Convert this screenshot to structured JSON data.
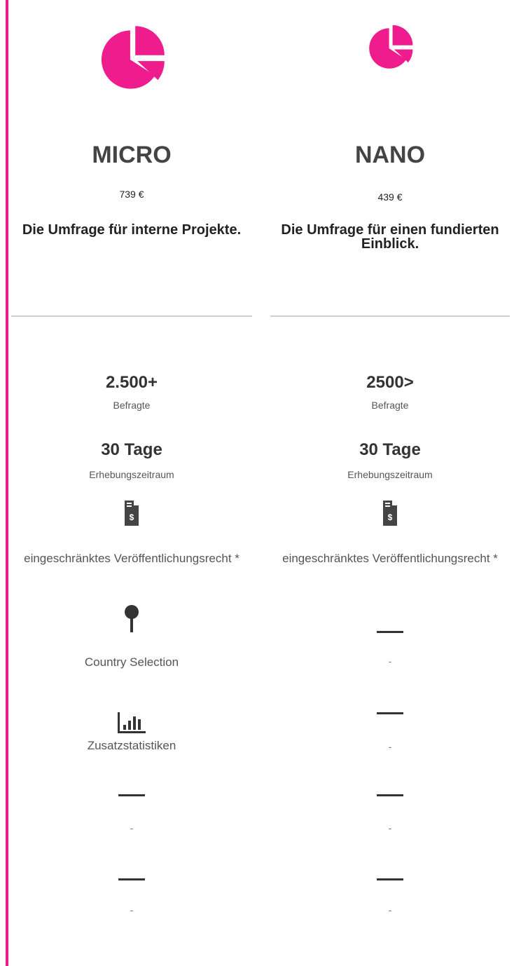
{
  "theme": {
    "accent": "#ee1c8c"
  },
  "plans": [
    {
      "icon": "pie-chart-icon",
      "name": "MICRO",
      "price": "739 €",
      "tagline": "Die Umfrage für interne Projekte.",
      "respondents": {
        "value": "2.500+",
        "label": "Befragte"
      },
      "duration": {
        "value": "30 Tage",
        "label": "Erhebungszeitraum"
      },
      "features": [
        {
          "icon": "invoice-document-icon",
          "label": "eingeschränktes Veröffentlichungsrecht *"
        },
        {
          "icon": "map-pin-icon",
          "label": "Country Selection"
        },
        {
          "icon": "bar-chart-icon",
          "label": "Zusatzstatistiken"
        },
        {
          "icon": "dash-icon",
          "label": "-"
        },
        {
          "icon": "dash-icon",
          "label": "-"
        }
      ]
    },
    {
      "icon": "pie-chart-icon",
      "name": "NANO",
      "price": "439 €",
      "tagline": "Die Umfrage für einen fundierten Einblick.",
      "respondents": {
        "value": "2500>",
        "label": "Befragte"
      },
      "duration": {
        "value": "30 Tage",
        "label": "Erhebungszeitraum"
      },
      "features": [
        {
          "icon": "invoice-document-icon",
          "label": "eingeschränktes Veröffentlichungsrecht *"
        },
        {
          "icon": "dash-icon",
          "label": "-"
        },
        {
          "icon": "dash-icon",
          "label": "-"
        },
        {
          "icon": "dash-icon",
          "label": "-"
        },
        {
          "icon": "dash-icon",
          "label": "-"
        }
      ]
    }
  ]
}
